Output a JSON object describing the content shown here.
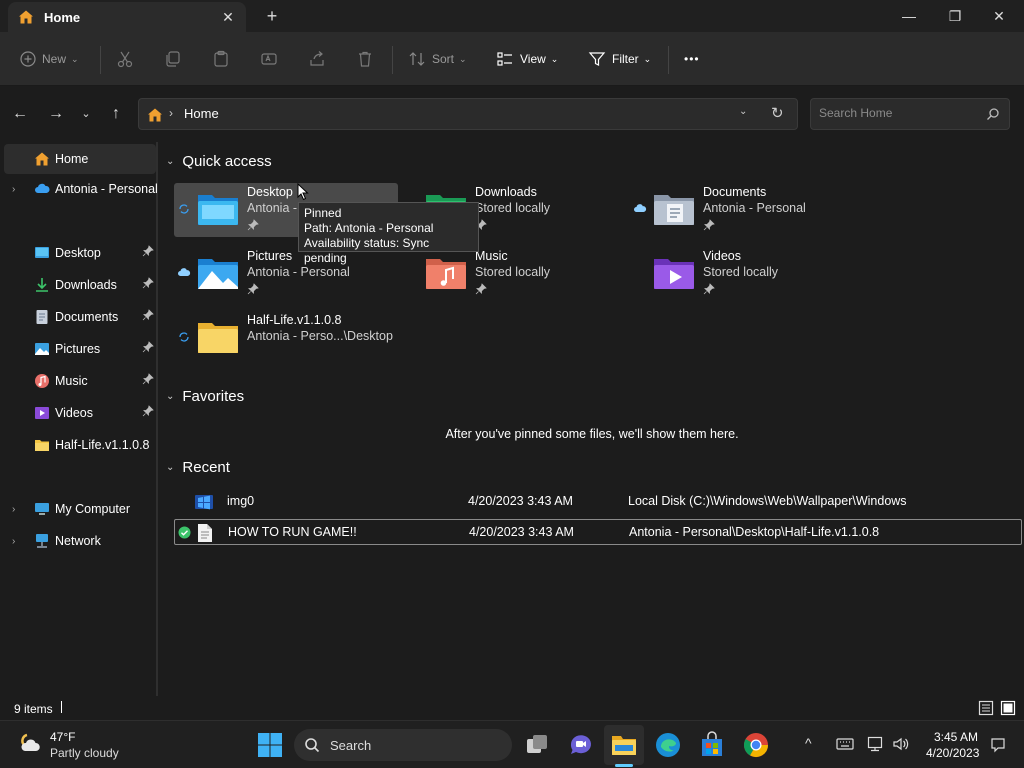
{
  "window": {
    "tab_title": "Home",
    "tab_close": "✕",
    "new_tab": "+",
    "minimize": "—",
    "maximize": "❐",
    "close": "✕"
  },
  "toolbar": {
    "new": "New",
    "sort": "Sort",
    "view": "View",
    "filter": "Filter",
    "more": "•••"
  },
  "address": {
    "location": "Home",
    "search_placeholder": "Search Home"
  },
  "sidebar": {
    "items": [
      {
        "label": "Home"
      },
      {
        "label": "Antonia - Personal"
      },
      {
        "label": "Desktop"
      },
      {
        "label": "Downloads"
      },
      {
        "label": "Documents"
      },
      {
        "label": "Pictures"
      },
      {
        "label": "Music"
      },
      {
        "label": "Videos"
      },
      {
        "label": "Half-Life.v1.1.0.8"
      },
      {
        "label": "My Computer"
      },
      {
        "label": "Network"
      }
    ]
  },
  "quick_access": {
    "header": "Quick access",
    "items": [
      {
        "name": "Desktop",
        "sub": "Antonia -"
      },
      {
        "name": "Downloads",
        "sub": "Stored locally"
      },
      {
        "name": "Documents",
        "sub": "Antonia - Personal"
      },
      {
        "name": "Pictures",
        "sub": "Antonia - Personal"
      },
      {
        "name": "Music",
        "sub": "Stored locally"
      },
      {
        "name": "Videos",
        "sub": "Stored locally"
      },
      {
        "name": "Half-Life.v1.1.0.8",
        "sub": "Antonia - Perso...\\Desktop"
      }
    ]
  },
  "tooltip": {
    "line1": "Pinned",
    "line2": "Path: Antonia - Personal",
    "line3": "Availability status: Sync pending"
  },
  "favorites": {
    "header": "Favorites",
    "empty": "After you've pinned some files, we'll show them here."
  },
  "recent": {
    "header": "Recent",
    "rows": [
      {
        "name": "img0",
        "date": "4/20/2023 3:43 AM",
        "path": "Local Disk (C:)\\Windows\\Web\\Wallpaper\\Windows"
      },
      {
        "name": "HOW TO RUN GAME!!",
        "date": "4/20/2023 3:43 AM",
        "path": "Antonia - Personal\\Desktop\\Half-Life.v1.1.0.8"
      }
    ]
  },
  "status": {
    "count": "9 items"
  },
  "taskbar": {
    "weather_temp": "47°F",
    "weather_desc": "Partly cloudy",
    "search": "Search",
    "time": "3:45 AM",
    "date": "4/20/2023"
  },
  "colors": {
    "accent": "#60cdff",
    "folder_yellow": "#f4c542",
    "background": "#1c1c1c"
  }
}
